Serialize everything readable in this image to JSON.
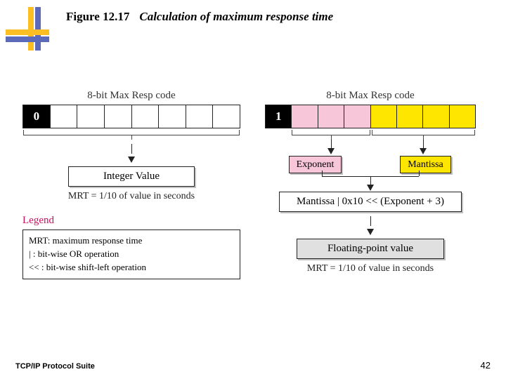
{
  "figure": {
    "number": "Figure 12.17",
    "title": "Calculation of maximum response time"
  },
  "left": {
    "header": "8-bit Max Resp code",
    "firstBit": "0",
    "box": "Integer Value",
    "formula": "MRT = 1/10 of value in seconds"
  },
  "legend": {
    "title": "Legend",
    "line1": "MRT: maximum response time",
    "line2": "| : bit-wise OR operation",
    "line3": "<< : bit-wise shift-left operation"
  },
  "right": {
    "header": "8-bit Max Resp code",
    "firstBit": "1",
    "exponent": "Exponent",
    "mantissa": "Mantissa",
    "op": "Mantissa | 0x10  <<  (Exponent + 3)",
    "fp": "Floating-point value",
    "formula": "MRT = 1/10 of value in seconds"
  },
  "footer": "TCP/IP Protocol Suite",
  "page": "42"
}
